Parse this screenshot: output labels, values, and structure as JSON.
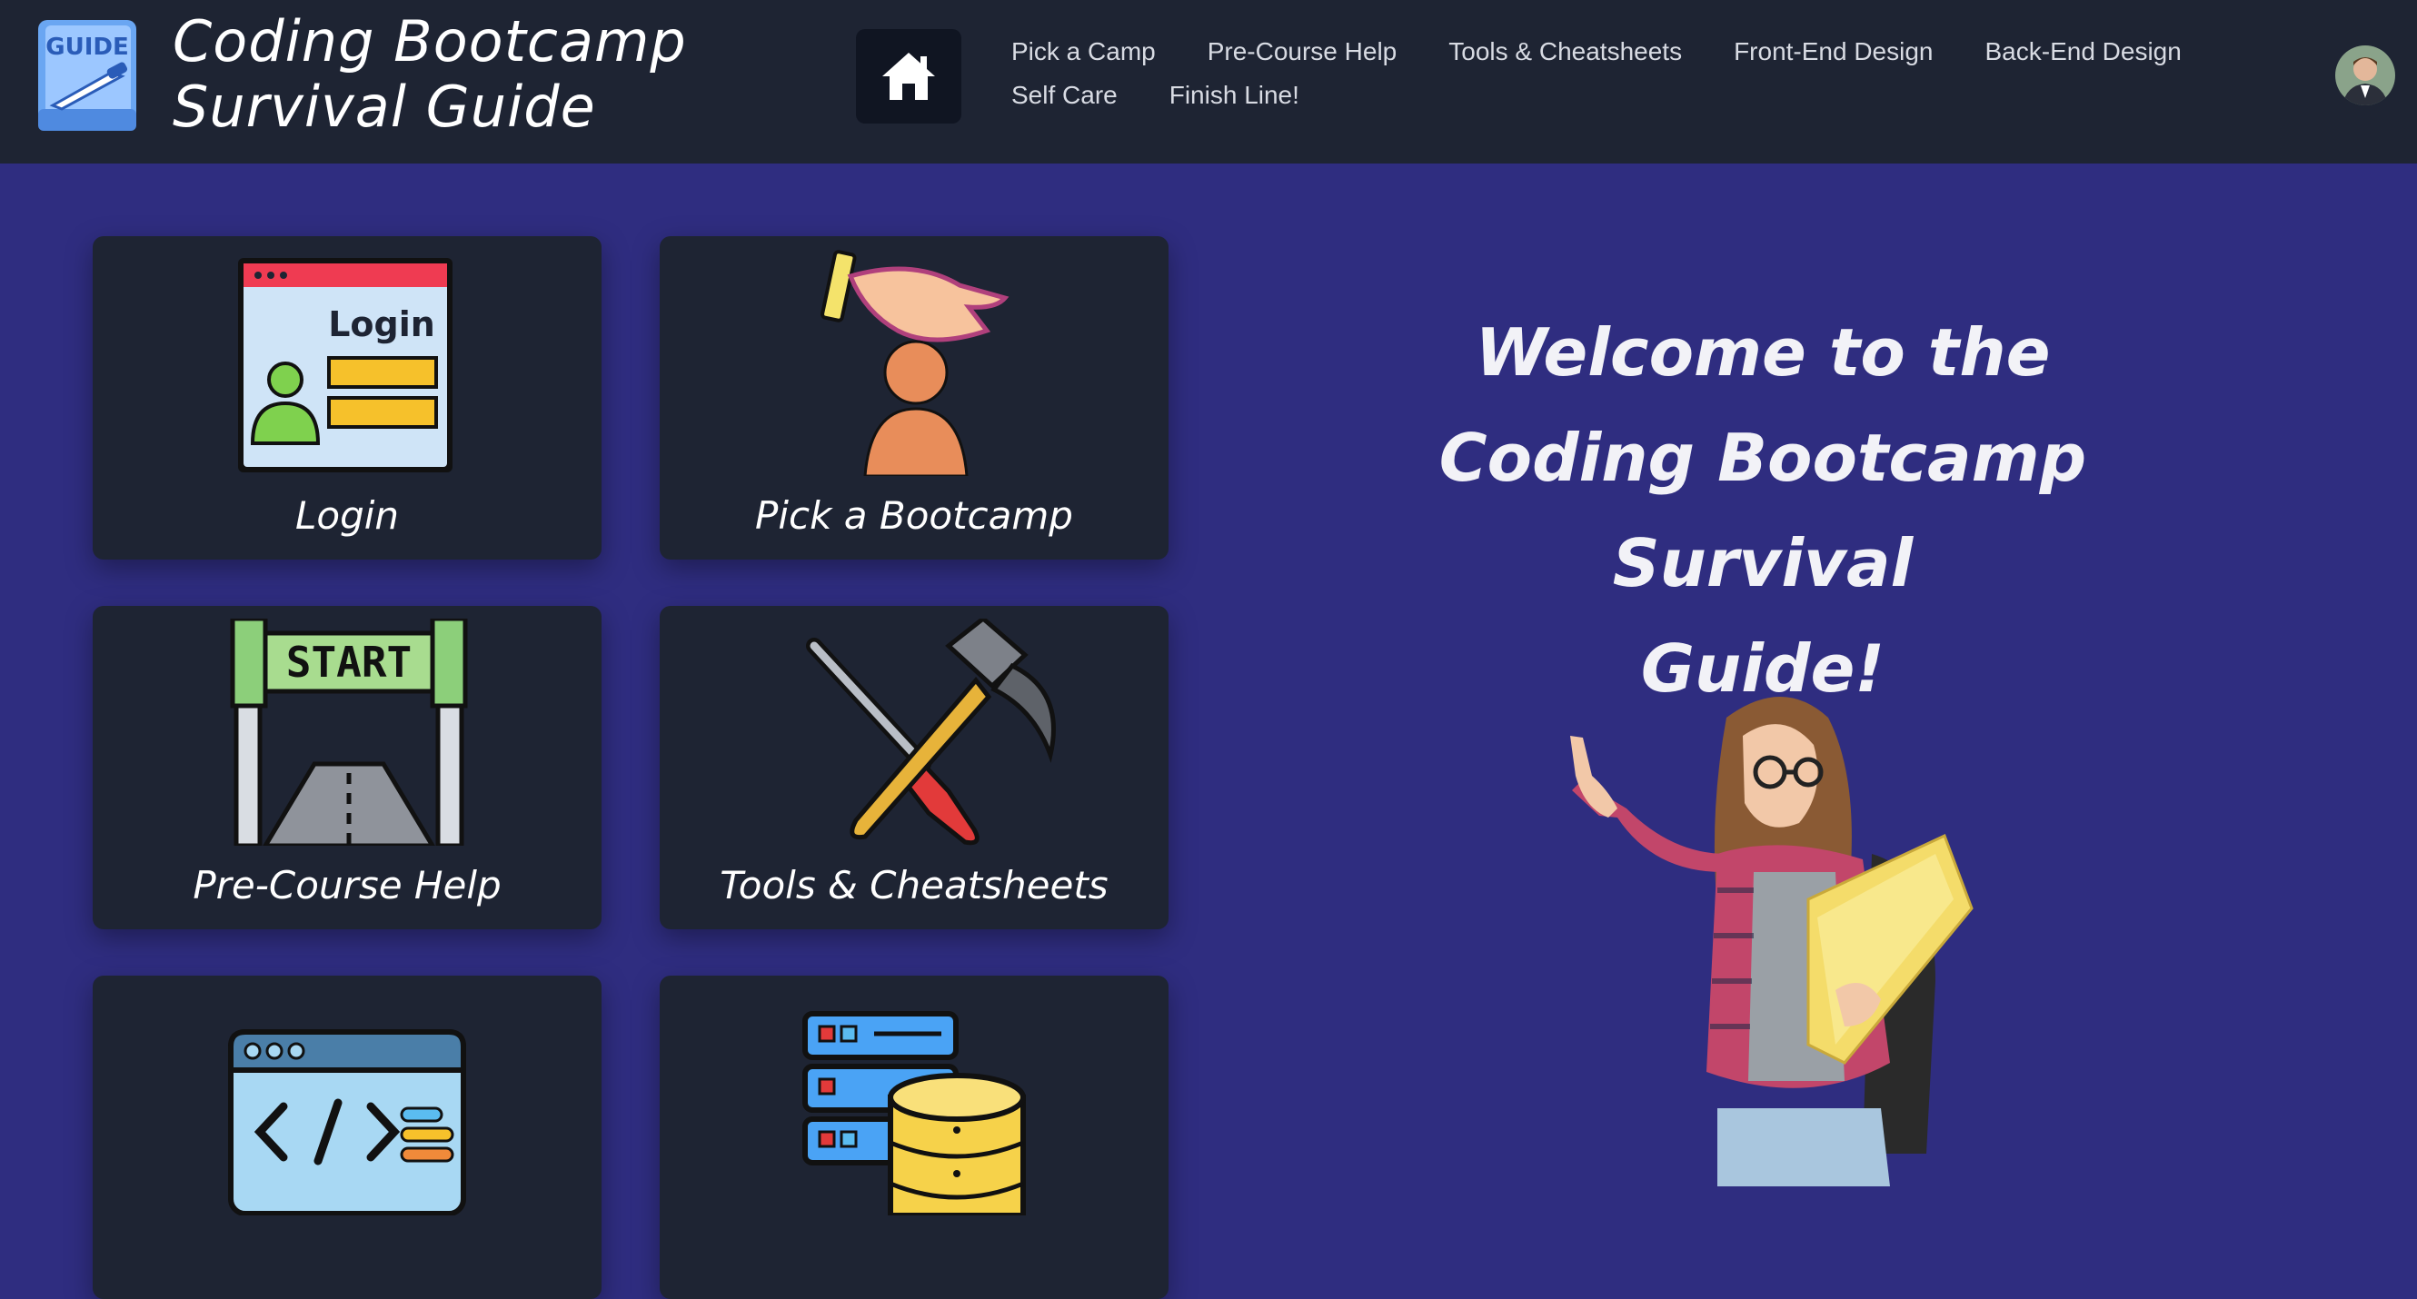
{
  "header": {
    "brand_line1": "Coding Bootcamp",
    "brand_line2": "Survival Guide",
    "logo_text": "GUIDE",
    "home_icon": "home-icon",
    "nav": [
      {
        "label": "Pick a Camp"
      },
      {
        "label": "Pre-Course Help"
      },
      {
        "label": "Tools & Cheatsheets"
      },
      {
        "label": "Front-End Design"
      },
      {
        "label": "Back-End Design"
      },
      {
        "label": "Self Care"
      },
      {
        "label": "Finish Line!"
      }
    ]
  },
  "cards": [
    {
      "label": "Login",
      "icon": "login-window-icon",
      "icon_text": "Login"
    },
    {
      "label": "Pick a Bootcamp",
      "icon": "hand-picking-person-icon"
    },
    {
      "label": "Pre-Course Help",
      "icon": "start-gate-icon",
      "icon_text": "START"
    },
    {
      "label": "Tools & Cheatsheets",
      "icon": "tools-icon"
    },
    {
      "label": "",
      "icon": "code-window-icon"
    },
    {
      "label": "",
      "icon": "server-database-icon"
    }
  ],
  "welcome": {
    "line1": "Welcome to the",
    "line2": "Coding Bootcamp Survival",
    "line3": "Guide!"
  },
  "colors": {
    "page_bg": "#2f2d80",
    "header_bg": "#1e2433",
    "card_bg": "#1e2433",
    "text": "#ffffff"
  }
}
